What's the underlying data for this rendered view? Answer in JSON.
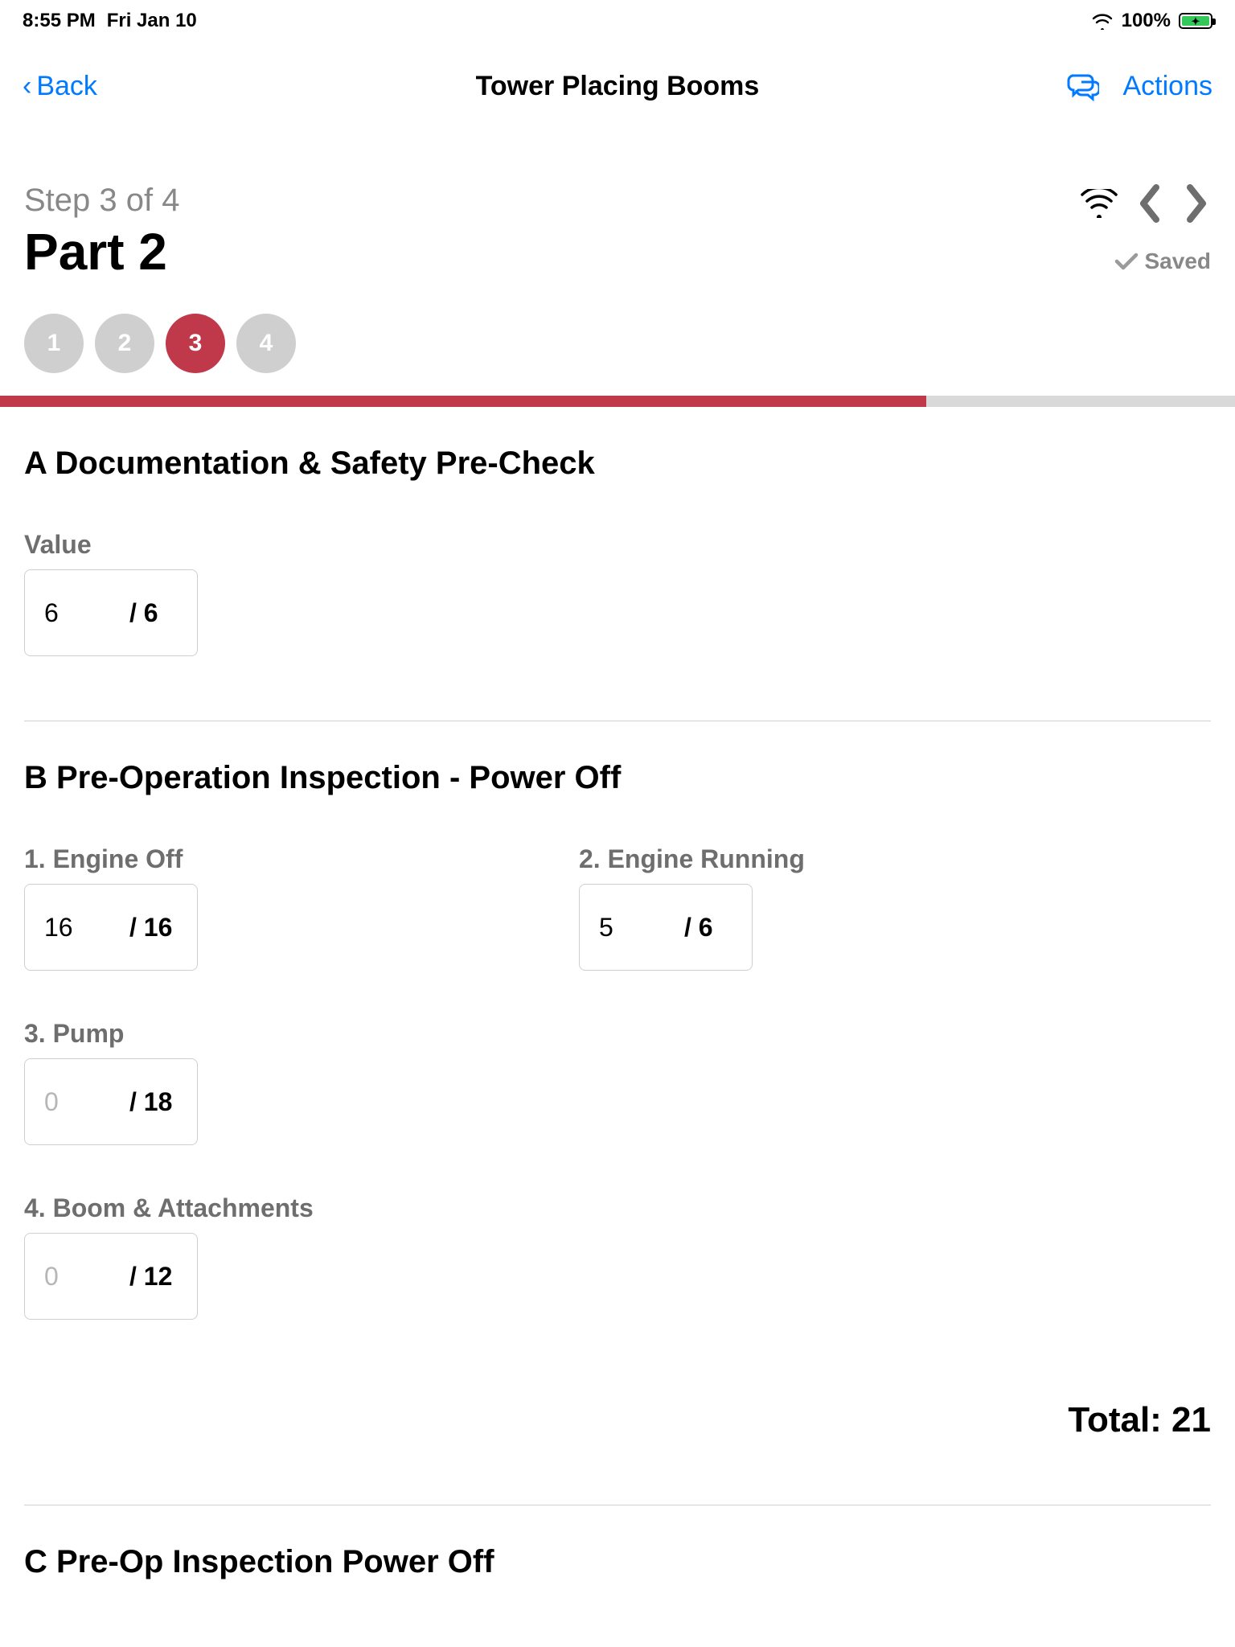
{
  "status": {
    "time": "8:55 PM",
    "date": "Fri Jan 10",
    "battery_pct": "100%"
  },
  "nav": {
    "back": "Back",
    "title": "Tower Placing Booms",
    "actions": "Actions"
  },
  "header": {
    "step_label": "Step 3 of 4",
    "part_title": "Part 2",
    "saved": "Saved"
  },
  "steps": {
    "dots": [
      "1",
      "2",
      "3",
      "4"
    ],
    "active_index": 2,
    "progress_pct": 75
  },
  "section_a": {
    "title": "A Documentation & Safety Pre-Check",
    "value_label": "Value",
    "value": "6",
    "max": "/ 6"
  },
  "section_b": {
    "title": "B Pre-Operation Inspection - Power Off",
    "items": [
      {
        "label": "1. Engine Off",
        "value": "16",
        "max": "/ 16"
      },
      {
        "label": "2. Engine Running",
        "value": "5",
        "max": "/ 6"
      },
      {
        "label": "3. Pump",
        "value": "",
        "placeholder": "0",
        "max": "/ 18"
      },
      {
        "label": "4. Boom & Attachments",
        "value": "",
        "placeholder": "0",
        "max": "/ 12"
      }
    ],
    "total_label": "Total: ",
    "total_value": "21"
  },
  "section_c": {
    "title": "C Pre-Op Inspection Power Off"
  }
}
